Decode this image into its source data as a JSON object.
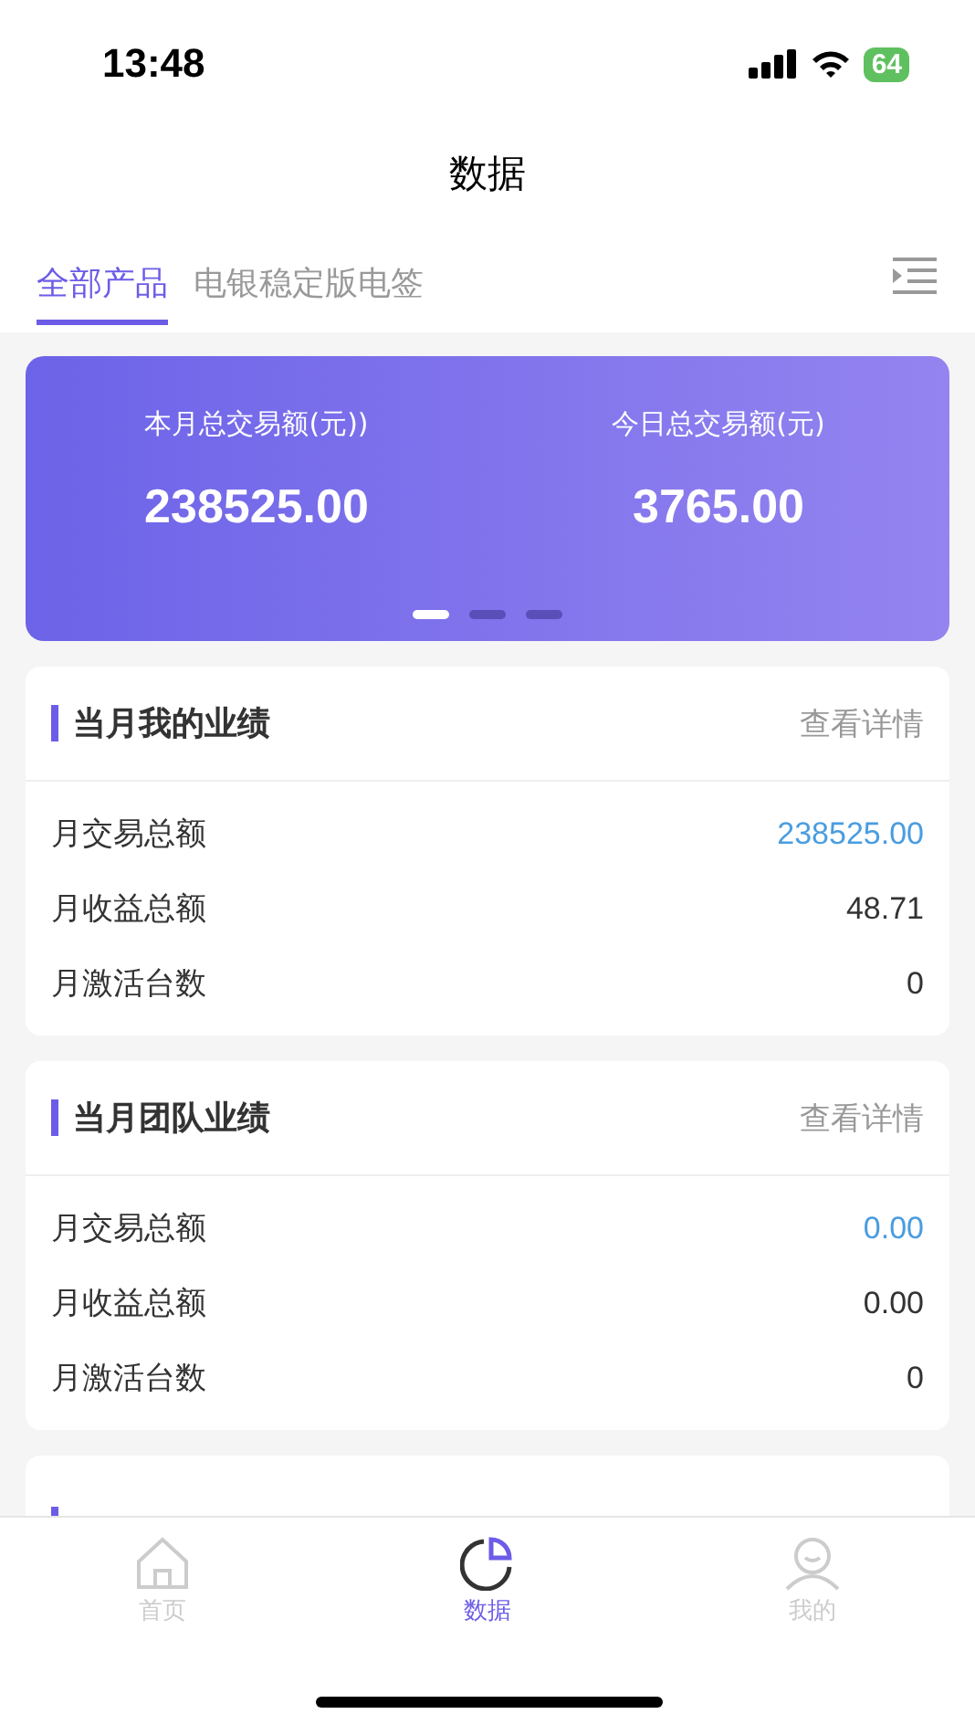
{
  "status_bar": {
    "time": "13:48",
    "battery": "64"
  },
  "title": "数据",
  "tabs": [
    {
      "label": "全部产品",
      "selected": true
    },
    {
      "label": "电银稳定版电签",
      "selected": false
    }
  ],
  "banner": {
    "stats": [
      {
        "label": "本月总交易额(元))",
        "value": "238525.00"
      },
      {
        "label": "今日总交易额(元)",
        "value": "3765.00"
      }
    ],
    "dots": [
      {
        "selected": true
      },
      {
        "selected": false
      },
      {
        "selected": false
      }
    ]
  },
  "cards": [
    {
      "title": "当月我的业绩",
      "link": "查看详情",
      "rows": [
        {
          "label": "月交易总额",
          "value": "238525.00",
          "highlight": true
        },
        {
          "label": "月收益总额",
          "value": "48.71",
          "highlight": false
        },
        {
          "label": "月激活台数",
          "value": "0",
          "highlight": false
        }
      ]
    },
    {
      "title": "当月团队业绩",
      "link": "查看详情",
      "rows": [
        {
          "label": "月交易总额",
          "value": "0.00",
          "highlight": true
        },
        {
          "label": "月收益总额",
          "value": "0.00",
          "highlight": false
        },
        {
          "label": "月激活台数",
          "value": "0",
          "highlight": false
        }
      ]
    }
  ],
  "tab_bar": [
    {
      "kind": "home",
      "label": "首页",
      "selected": false
    },
    {
      "kind": "data",
      "label": "数据",
      "selected": true
    },
    {
      "kind": "me",
      "label": "我的",
      "selected": false
    }
  ]
}
